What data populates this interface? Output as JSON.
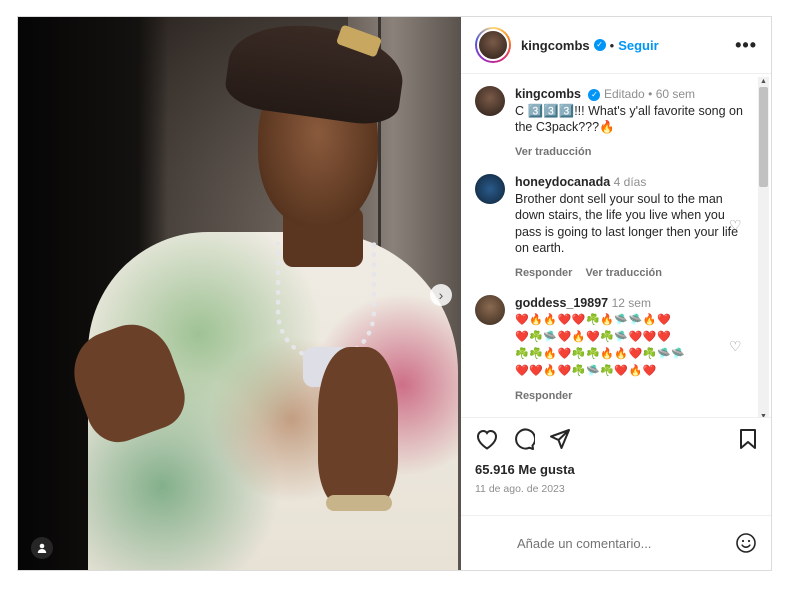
{
  "header": {
    "username": "kingcombs",
    "follow_label": "Seguir",
    "more_label": "•••"
  },
  "caption": {
    "username": "kingcombs",
    "edited": "Editado",
    "age": "60 sem",
    "text": "C 3️⃣3️⃣3️⃣!!! What's y'all favorite song on the C3pack???🔥",
    "translate": "Ver traducción"
  },
  "comments": [
    {
      "username": "honeydocanada",
      "age": "4 días",
      "text": "Brother dont sell your soul to the man down stairs, the life you live when you pass is going to last longer then your life on earth.",
      "reply": "Responder",
      "translate": "Ver traducción"
    },
    {
      "username": "goddess_19897",
      "age": "12 sem",
      "emoji_lines": [
        "❤️🔥🔥❤️❤️☘️🔥🛸🛸🔥❤️",
        "❤️☘️🛸❤️🔥❤️☘️🛸❤️❤️❤️",
        "☘️☘️🔥❤️☘️☘️🔥🔥❤️☘️🛸🛸",
        "❤️❤️🔥❤️☘️🛸☘️❤️🔥❤️"
      ],
      "reply": "Responder"
    }
  ],
  "actions": {
    "likes": "65.916 Me gusta",
    "date": "11 de ago. de 2023"
  },
  "add_comment": {
    "placeholder": "Añade un comentario..."
  },
  "icons": {
    "like": "heart-icon",
    "comment": "comment-icon",
    "share": "share-icon",
    "save": "bookmark-icon",
    "emoji": "smiley-icon",
    "next": "chevron-right-icon",
    "tag": "user-tag-icon"
  }
}
